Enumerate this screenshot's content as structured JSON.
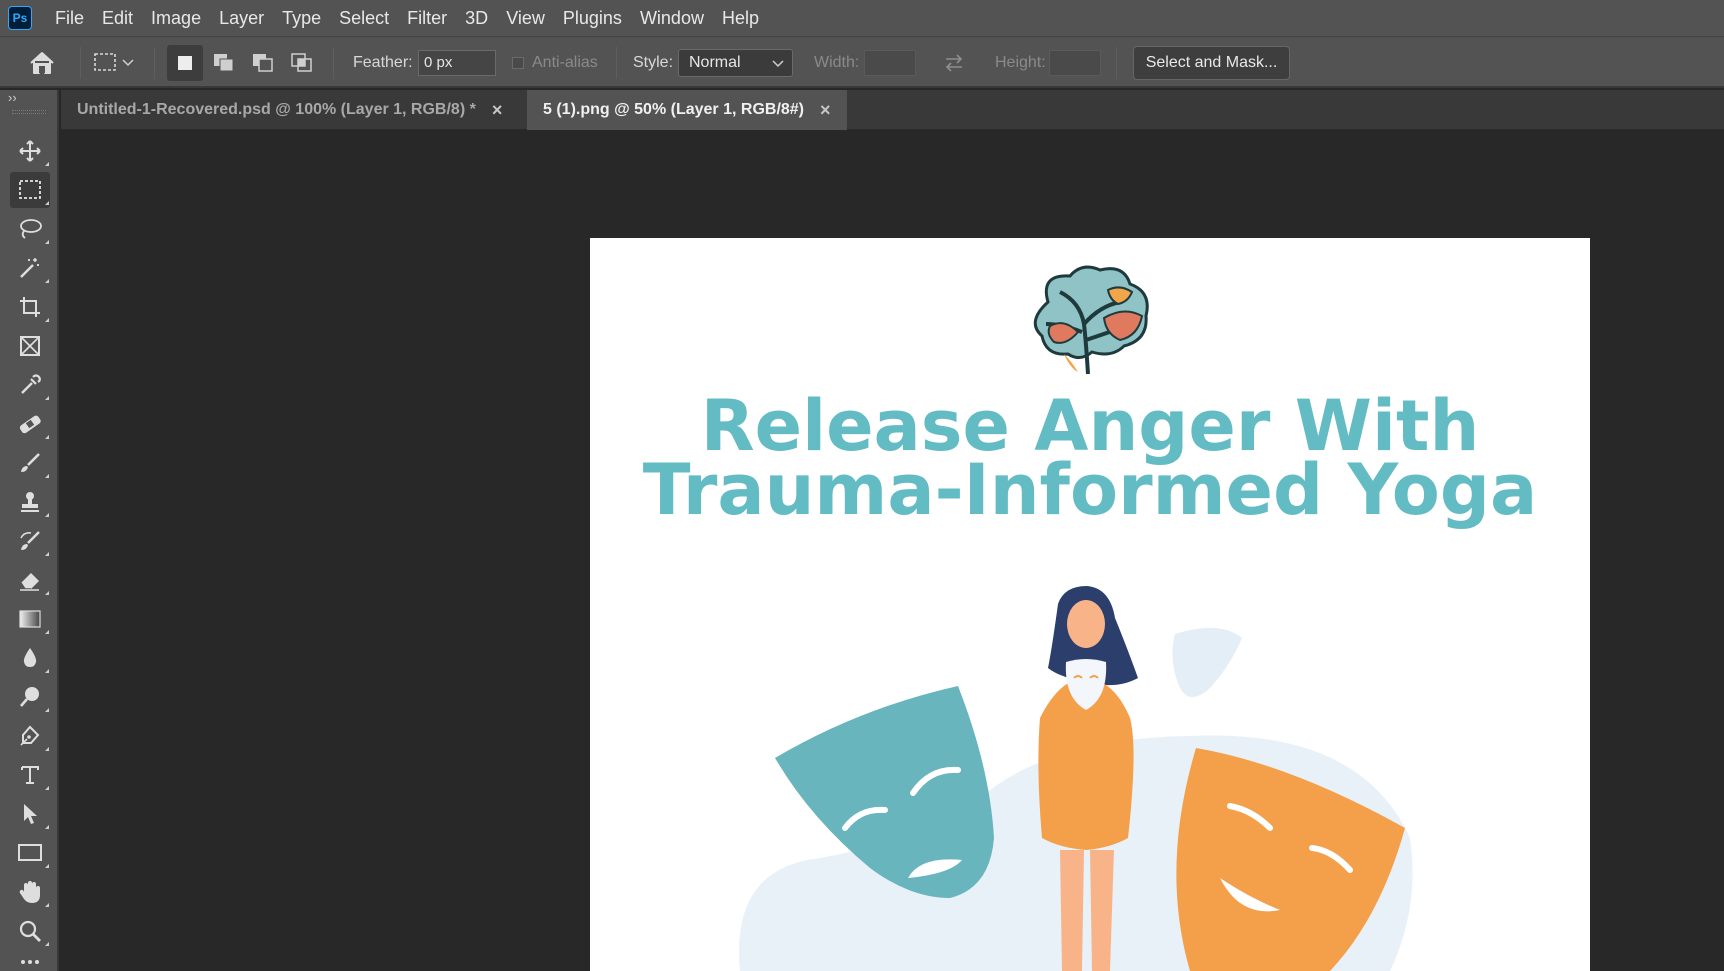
{
  "app": {
    "logo_text": "Ps"
  },
  "menu": [
    "File",
    "Edit",
    "Image",
    "Layer",
    "Type",
    "Select",
    "Filter",
    "3D",
    "View",
    "Plugins",
    "Window",
    "Help"
  ],
  "options": {
    "feather_label": "Feather:",
    "feather_value": "0 px",
    "antialias_label": "Anti-alias",
    "style_label": "Style:",
    "style_value": "Normal",
    "width_label": "Width:",
    "width_value": "",
    "height_label": "Height:",
    "height_value": "",
    "select_and_mask": "Select and Mask..."
  },
  "tabs": [
    {
      "label": "Untitled-1-Recovered.psd @ 100% (Layer 1, RGB/8) *",
      "active": false
    },
    {
      "label": "5 (1).png @ 50% (Layer 1, RGB/8#)",
      "active": true
    }
  ],
  "tabs_close_glyph": "×",
  "document": {
    "title_line1": "Release Anger With",
    "title_line2": "Trauma-Informed Yoga",
    "title_color": "#63bcc4"
  },
  "tools": [
    "move-tool",
    "rectangular-marquee-tool",
    "lasso-tool",
    "magic-wand-tool",
    "crop-tool",
    "frame-tool",
    "eyedropper-tool",
    "healing-brush-tool",
    "brush-tool",
    "clone-stamp-tool",
    "history-brush-tool",
    "eraser-tool",
    "gradient-tool",
    "blur-tool",
    "dodge-tool",
    "pen-tool",
    "type-tool",
    "path-selection-tool",
    "rectangle-tool",
    "hand-tool",
    "zoom-tool",
    "more-tools"
  ]
}
